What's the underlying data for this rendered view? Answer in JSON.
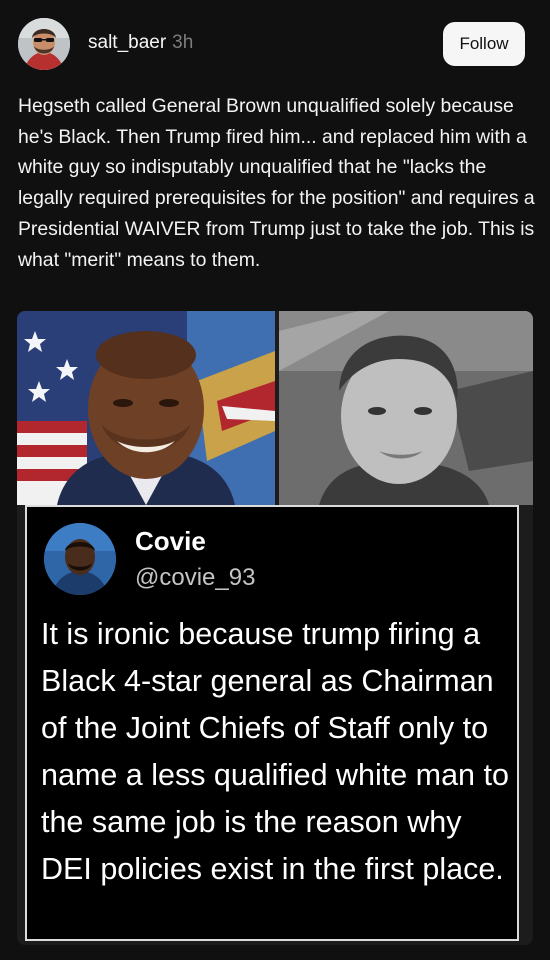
{
  "post": {
    "username": "salt_baer",
    "timestamp": "3h",
    "follow_label": "Follow",
    "text": "Hegseth called General Brown unqualified solely because he's Black. Then Trump fired him... and replaced him with a white guy so indisputably unqualified that he \"lacks the legally required prerequisites for the position\" and requires a Presidential WAIVER from Trump just to take the job. This is what \"merit\" means to them."
  },
  "tweet": {
    "name": "Covie",
    "handle": "@covie_93",
    "text": "It is ironic because trump firing a Black 4-star general as Chairman of the Joint Chiefs of Staff only to name a less qualified white man to the same job is the reason why DEI policies exist in the first place."
  },
  "colors": {
    "background": "#101010",
    "text_primary": "#f3f3f3",
    "text_muted": "#7d7d7d",
    "follow_button_bg": "#f6f6f6",
    "tweet_border": "#dcdcdc"
  }
}
